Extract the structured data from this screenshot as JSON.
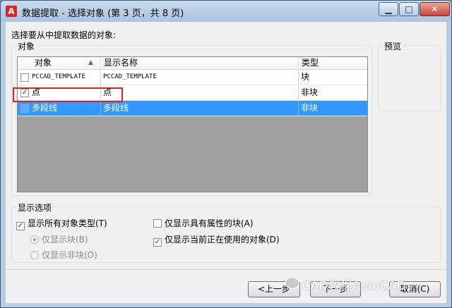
{
  "window": {
    "title": "数据提取 - 选择对象 (第 3 页，共 8 页)",
    "app_icon_glyph": "A",
    "minimize_glyph": "▁",
    "maximize_glyph": "□",
    "close_glyph": "✕"
  },
  "prompt": "选择要从中提取数据的对象:",
  "objects_group": {
    "label": "对象",
    "columns": [
      "对象",
      "显示名称",
      "类型"
    ],
    "sort_indicator": "▲",
    "rows": [
      {
        "object": "PCCAD_TEMPLATE",
        "display": "PCCAD_TEMPLATE",
        "type": "块",
        "checked": false,
        "check_glyph": ""
      },
      {
        "object": "点",
        "display": "点",
        "type": "非块",
        "checked": true,
        "check_glyph": "✓"
      },
      {
        "object": "多段线",
        "display": "多段线",
        "type": "非块",
        "checked": false,
        "check_glyph": ""
      }
    ]
  },
  "preview_group": {
    "label": "预览"
  },
  "display_options": {
    "label": "显示选项",
    "show_all_types": {
      "label": "显示所有对象类型(T)",
      "checked": true,
      "check_glyph": "✓"
    },
    "blocks_only": {
      "label": "仅显示块(B)",
      "selected": true
    },
    "nonblocks_only": {
      "label": "仅显示非块(O)",
      "selected": false
    },
    "blocks_with_attributes": {
      "label": "仅显示具有属性的块(A)",
      "checked": false,
      "check_glyph": ""
    },
    "in_use_only": {
      "label": "仅显示当前正在使用的对象(D)",
      "checked": true,
      "check_glyph": "✓"
    }
  },
  "buttons": {
    "back": "<上一步",
    "next": "下一步",
    "cancel": "取消(C)"
  },
  "watermark": "CAD教程AutoCAD"
}
